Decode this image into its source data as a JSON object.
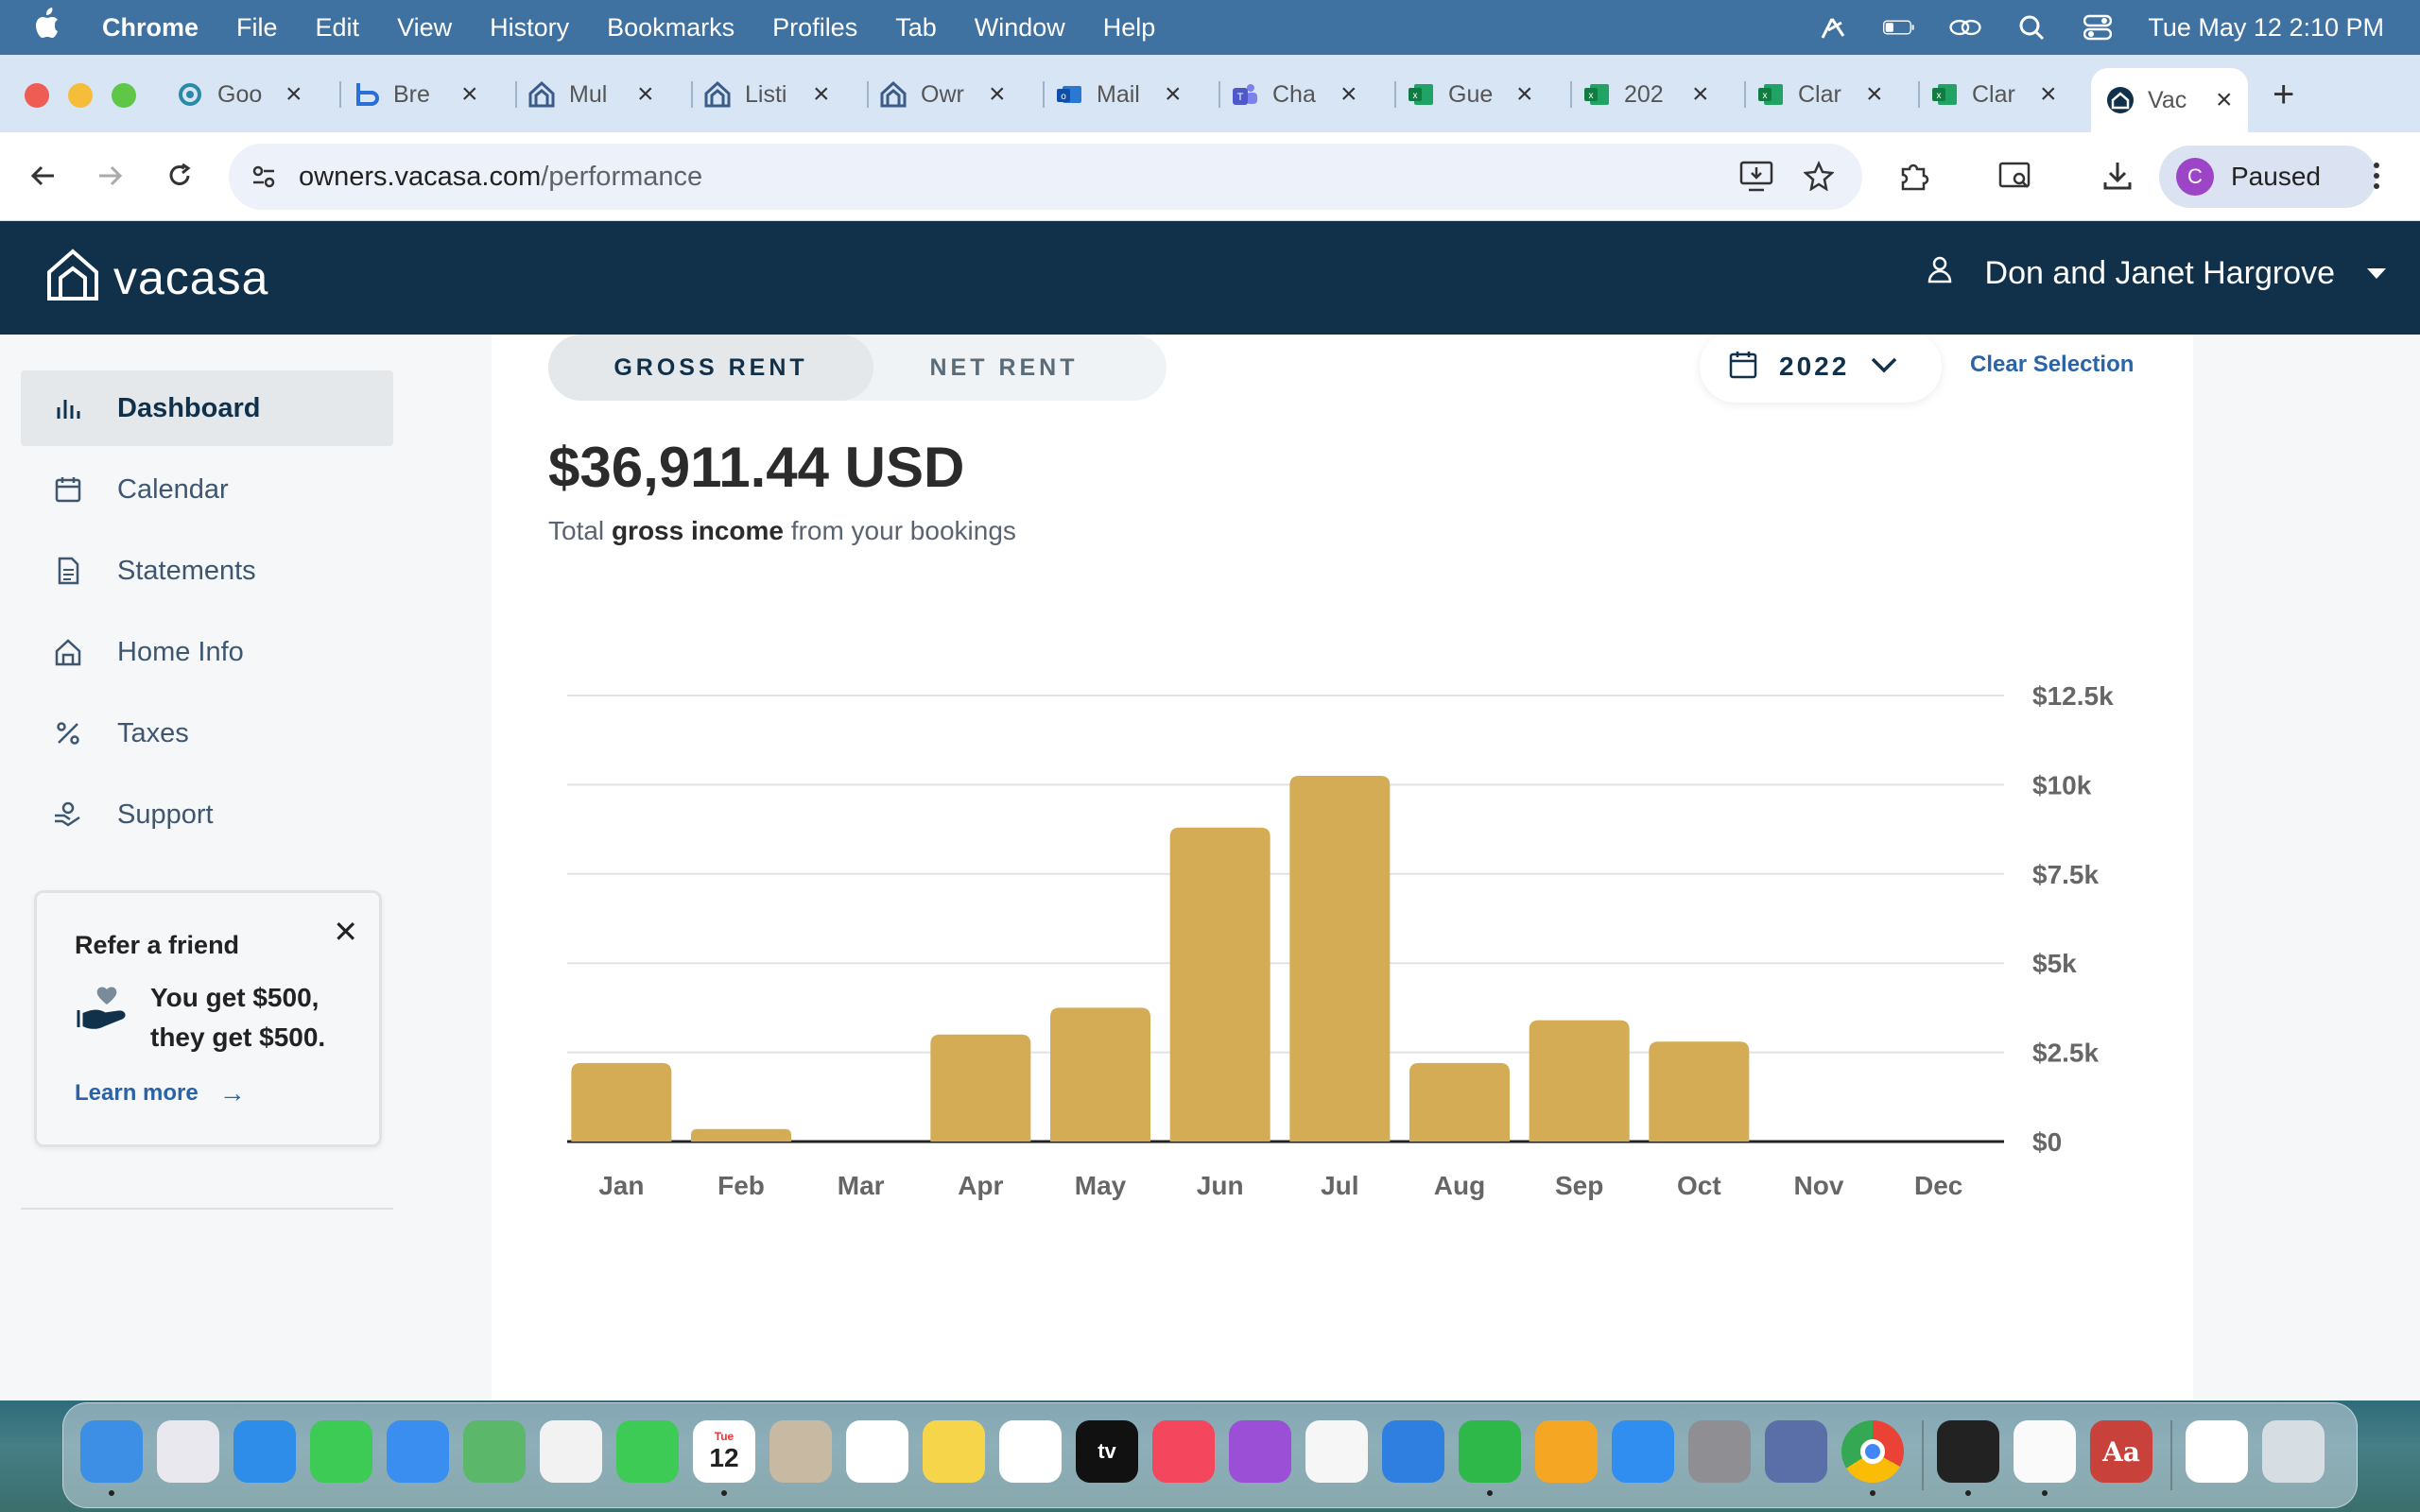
{
  "menubar": {
    "app": "Chrome",
    "items": [
      "File",
      "Edit",
      "View",
      "History",
      "Bookmarks",
      "Profiles",
      "Tab",
      "Window",
      "Help"
    ],
    "clock": "Tue May 12  2:10 PM"
  },
  "tabs": [
    {
      "label": "Goo",
      "icon": "gear-icon"
    },
    {
      "label": "Bre",
      "icon": "b-icon"
    },
    {
      "label": "Mul",
      "icon": "vacasa-icon"
    },
    {
      "label": "Listi",
      "icon": "vacasa-icon"
    },
    {
      "label": "Owr",
      "icon": "vacasa-icon"
    },
    {
      "label": "Mail",
      "icon": "outlook-icon"
    },
    {
      "label": "Cha",
      "icon": "teams-icon"
    },
    {
      "label": "Gue",
      "icon": "excel-icon"
    },
    {
      "label": "202",
      "icon": "excel-icon"
    },
    {
      "label": "Clar",
      "icon": "excel-icon"
    },
    {
      "label": "Clar",
      "icon": "excel-icon"
    },
    {
      "label": "Vac",
      "icon": "vacasa-icon",
      "active": true
    }
  ],
  "address": {
    "host": "owners.vacasa.com",
    "path": "/performance"
  },
  "profile": {
    "initial": "C",
    "status": "Paused"
  },
  "header": {
    "brand": "vacasa",
    "user": "Don and Janet Hargrove"
  },
  "sidebar": {
    "items": [
      {
        "label": "Dashboard",
        "icon": "bar-chart-icon",
        "active": true
      },
      {
        "label": "Calendar",
        "icon": "calendar-icon"
      },
      {
        "label": "Statements",
        "icon": "document-icon"
      },
      {
        "label": "Home Info",
        "icon": "house-icon"
      },
      {
        "label": "Taxes",
        "icon": "percent-icon"
      },
      {
        "label": "Support",
        "icon": "support-icon"
      }
    ],
    "refer": {
      "title": "Refer a friend",
      "text": "You get $500, they get $500.",
      "link": "Learn more"
    }
  },
  "main": {
    "toggle": {
      "gross": "GROSS RENT",
      "net": "NET RENT",
      "selected": "gross"
    },
    "year": "2022",
    "clear": "Clear Selection",
    "total": "$36,911.44 USD",
    "subtitle_pre": "Total ",
    "subtitle_bold": "gross income",
    "subtitle_post": " from your bookings"
  },
  "chart_data": {
    "type": "bar",
    "categories": [
      "Jan",
      "Feb",
      "Mar",
      "Apr",
      "May",
      "Jun",
      "Jul",
      "Aug",
      "Sep",
      "Oct",
      "Nov",
      "Dec"
    ],
    "values": [
      2200,
      350,
      0,
      3000,
      3750,
      8800,
      10250,
      2200,
      3400,
      2800,
      0,
      0
    ],
    "ylim": [
      0,
      12500
    ],
    "yticks": [
      0,
      2500,
      5000,
      7500,
      10000,
      12500
    ],
    "ytick_labels": [
      "$0",
      "$2.5k",
      "$5k",
      "$7.5k",
      "$10k",
      "$12.5k"
    ],
    "bar_color": "#d4ac55",
    "grid": true,
    "title": "",
    "xlabel": "",
    "ylabel": ""
  },
  "dock": {
    "icons": [
      "finder-icon",
      "launchpad-icon",
      "safari-icon",
      "messages-icon",
      "mail-icon",
      "maps-icon",
      "photos-icon",
      "facetime-icon",
      "calendar-icon",
      "contacts-icon",
      "reminders-icon",
      "notes-icon",
      "freeform-icon",
      "tv-icon",
      "music-icon",
      "podcasts-icon",
      "news-icon",
      "keynote-icon",
      "numbers-icon",
      "pages-icon",
      "appstore-icon",
      "settings-icon",
      "iphone-mirroring-icon",
      "chrome-icon",
      "filemaker-icon",
      "textedit-icon",
      "dictionary-icon",
      "document-icon",
      "trash-icon"
    ],
    "calendar_day": "12",
    "calendar_month": "Tue",
    "tv_label": "tv",
    "dict_label": "Aa"
  },
  "colors": {
    "header_bg": "#11314b",
    "accent_link": "#2a63a8",
    "bar": "#d4ac55"
  }
}
